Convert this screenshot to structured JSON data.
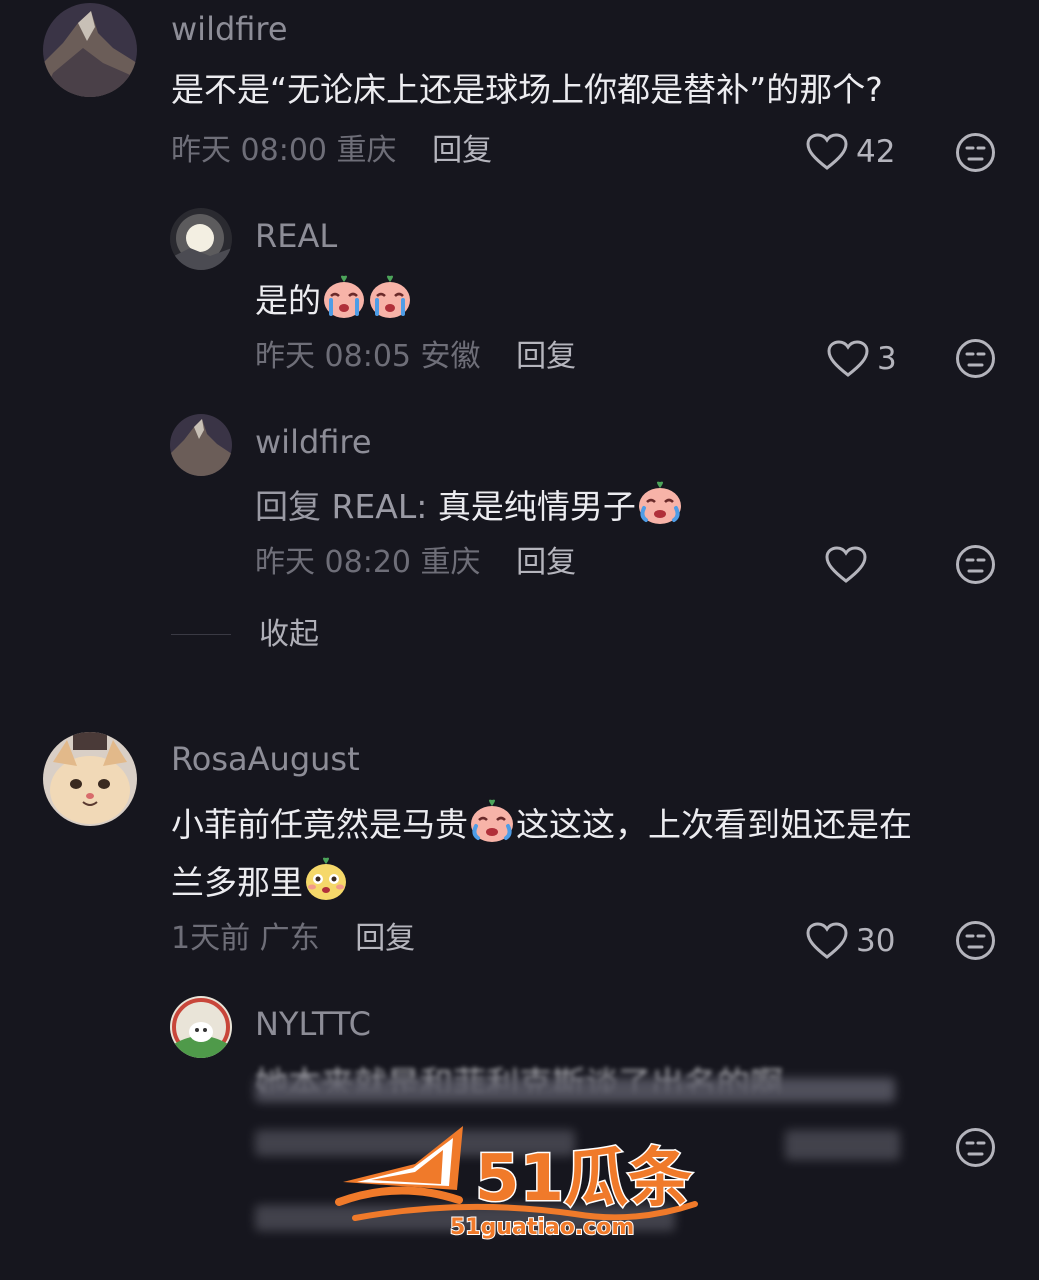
{
  "comments": [
    {
      "username": "wildfire",
      "text": "是不是“无论床上还是球场上你都是替补”的那个?",
      "time": "昨天 08:00",
      "location": "重庆",
      "reply_label": "回复",
      "likes": "42",
      "replies": [
        {
          "username": "REAL",
          "text": "是的",
          "emoji": [
            "cry-emoji",
            "cry-emoji"
          ],
          "time": "昨天 08:05",
          "location": "安徽",
          "reply_label": "回复",
          "likes": "3"
        },
        {
          "username": "wildfire",
          "reply_prefix": "回复 REAL:",
          "text": "真是纯情男子",
          "emoji": [
            "cry-emoji"
          ],
          "time": "昨天 08:20",
          "location": "重庆",
          "reply_label": "回复",
          "likes": ""
        }
      ],
      "collapse_label": "收起"
    },
    {
      "username": "RosaAugust",
      "text_line1": "小菲前任竟然是马贵",
      "text_line1_after": "这这这，上次看到姐还是在",
      "text_line2": "兰多那里",
      "time": "1天前",
      "location": "广东",
      "reply_label": "回复",
      "likes": "30",
      "replies": [
        {
          "username": "NYLTTC",
          "text": "她本来就是和菲利克斯谈了出名的啊",
          "blurred": true
        }
      ]
    }
  ],
  "watermark": {
    "brand": "51瓜条",
    "url": "51guatiao.com"
  },
  "colors": {
    "background": "#16161e",
    "accent_watermark": "#f07a2a"
  }
}
